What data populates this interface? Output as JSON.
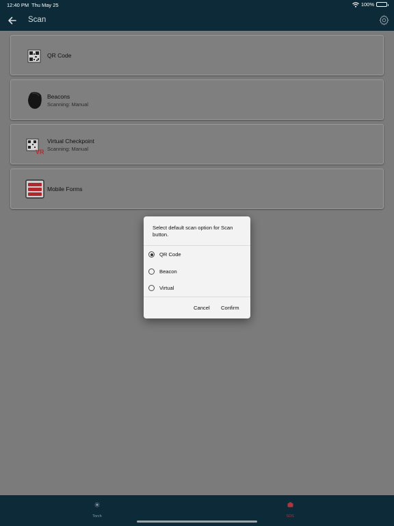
{
  "status_bar": {
    "time": "12:40 PM",
    "date": "Thu May 25",
    "battery": "100%"
  },
  "app_bar": {
    "title": "Scan",
    "back_icon": "arrow-left-icon",
    "settings_icon": "gear-icon"
  },
  "scan_options": [
    {
      "title": "QR Code",
      "subtitle": "",
      "icon": "qr-code-icon"
    },
    {
      "title": "Beacons",
      "subtitle": "Scanning: Manual",
      "icon": "beacon-icon"
    },
    {
      "title": "Virtual Checkpoint",
      "subtitle": "Scanning: Manual",
      "icon": "virtual-checkpoint-icon"
    },
    {
      "title": "Mobile Forms",
      "subtitle": "",
      "icon": "mobile-forms-icon"
    }
  ],
  "dialog": {
    "title": "Select default scan option for Scan button.",
    "options": [
      {
        "label": "QR Code",
        "selected": true
      },
      {
        "label": "Beacon",
        "selected": false
      },
      {
        "label": "Virtual",
        "selected": false
      }
    ],
    "cancel_label": "Cancel",
    "confirm_label": "Confirm"
  },
  "bottom_nav": {
    "torch_label": "Torch",
    "sos_label": "SOS",
    "sos_color": "#b3343a"
  },
  "colors": {
    "bar": "#0c2a38",
    "overlay_background": "#7b7b7b",
    "dialog_background": "#f3f3f3"
  }
}
